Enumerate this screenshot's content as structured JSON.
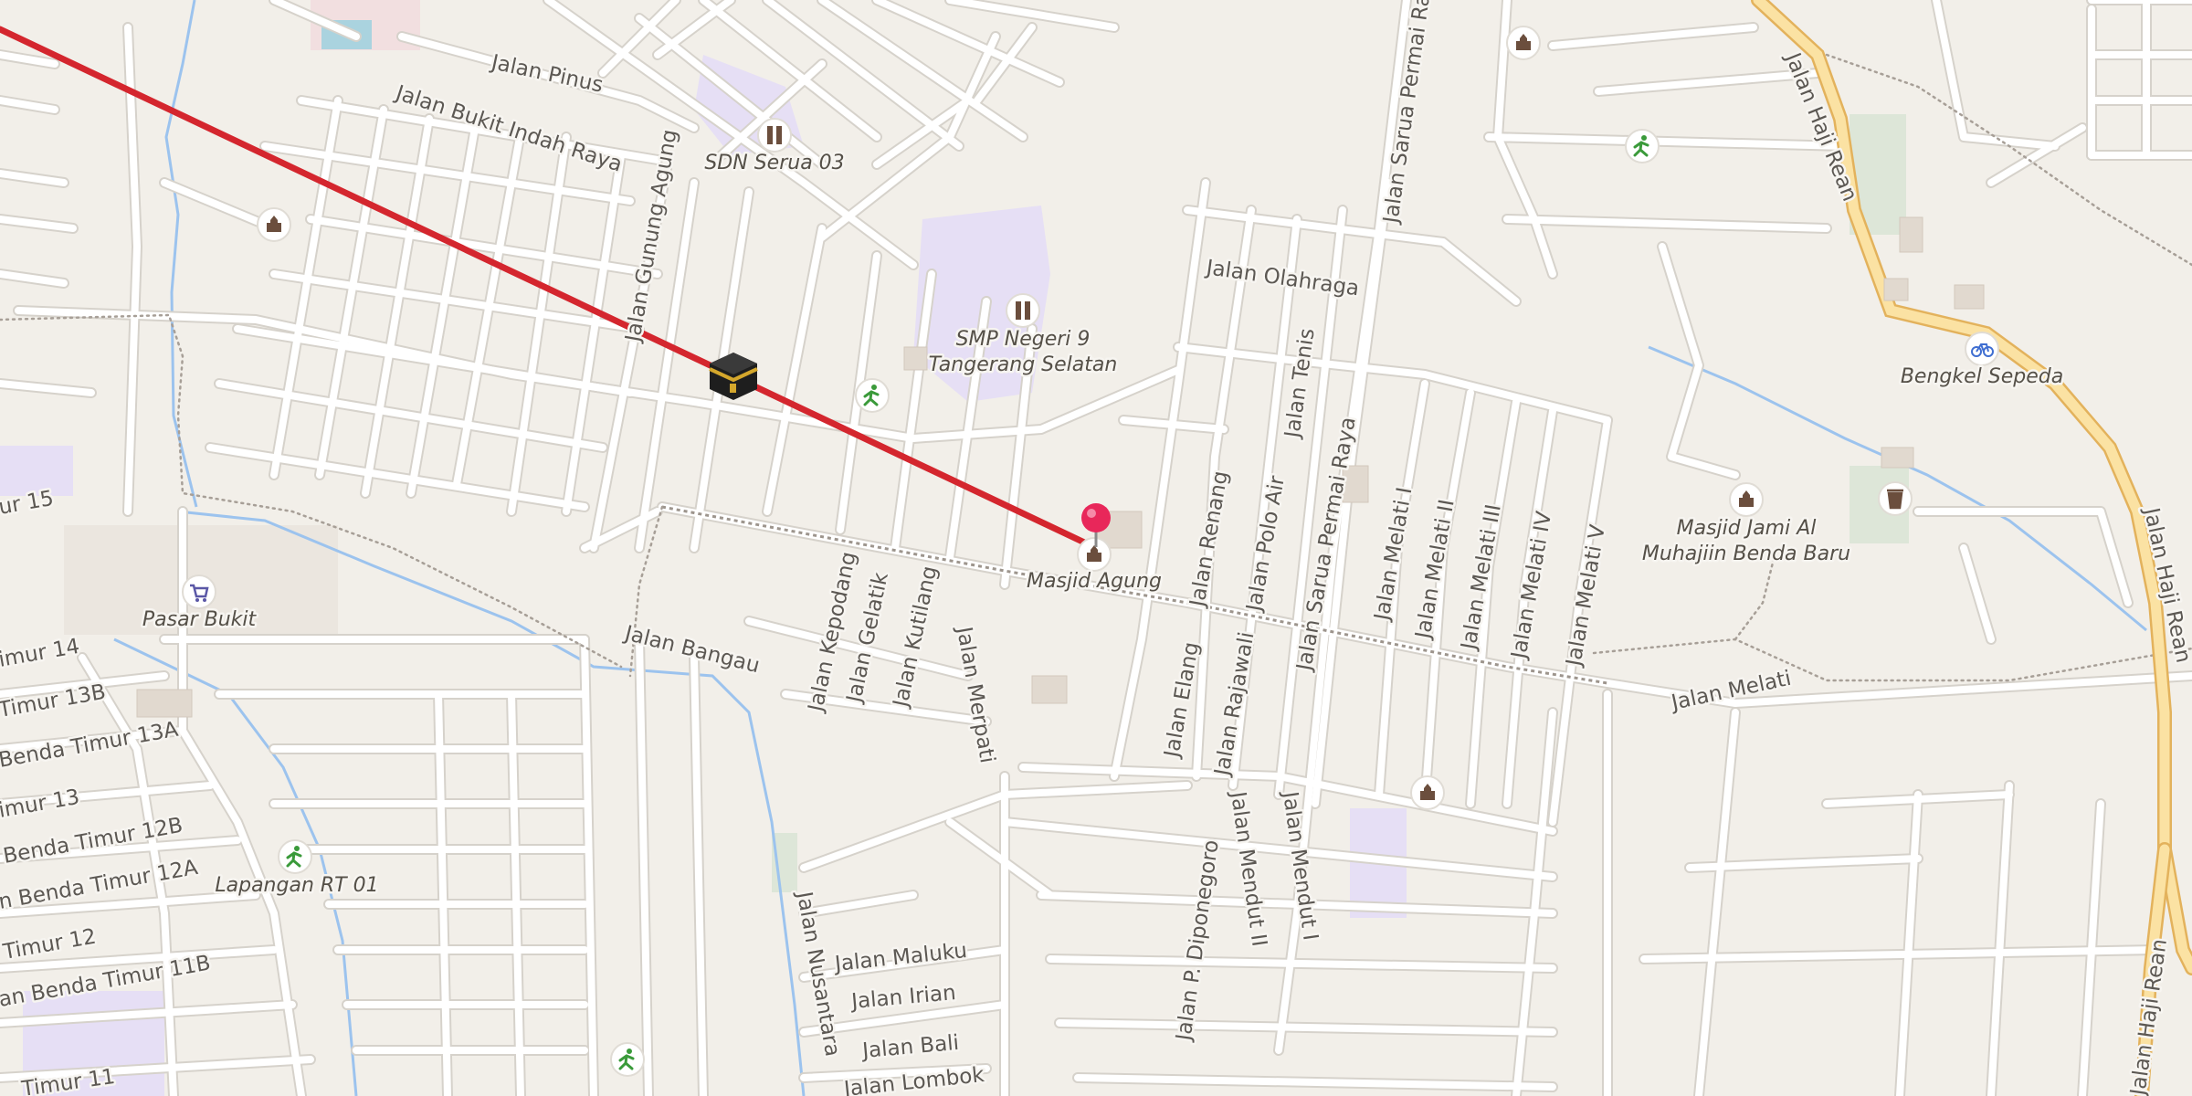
{
  "map": {
    "colors": {
      "background": "#f2efe9",
      "road": "#ffffff",
      "road_casing": "#d6d2cb",
      "major_road": "#fbe2a3",
      "major_road_casing": "#e3b25c",
      "route_line": "#d4262e",
      "pin": "#e8275a",
      "river": "#9cc3ee",
      "school_area": "#e6dff5",
      "park_area": "#dde6d8"
    },
    "streets": [
      "Jalan Pinus",
      "Jalan Bukit Indah Raya",
      "Jalan Gunung Agung",
      "Jalan Olahraga",
      "Jalan Sarua Permai Raya",
      "Jalan Sarua Permai Raya",
      "Jalan Tenis",
      "Jalan Polo Air",
      "Jalan Renang",
      "Jalan Rajawali",
      "Jalan Elang",
      "Jalan Melati I",
      "Jalan Melati II",
      "Jalan Melati III",
      "Jalan Melati IV",
      "Jalan Melati V",
      "Jalan Melati",
      "Jalan Haji Rean",
      "Jalan Haji Rean",
      "Jalan Haji Rean",
      "Jalan Bangau",
      "Jalan Kepodang",
      "Jalan Gelatik",
      "Jalan Kutilang",
      "Jalan Merpati",
      "Jalan P. Diponegoro",
      "Jalan Mendut II",
      "Jalan Mendut I",
      "Jalan Nusantara",
      "Jalan Maluku",
      "Jalan Irian",
      "Jalan Bali",
      "Jalan Lombok",
      "ur 15",
      "imur 14",
      "Timur 13B",
      "Benda Timur 13A",
      "imur 13",
      "Benda Timur 12B",
      "n Benda Timur 12A",
      "Timur 12",
      "an Benda Timur 11B",
      "Timur 11"
    ],
    "pois": [
      {
        "name": "SDN Serua 03",
        "icon": "school-icon"
      },
      {
        "name": "SMP Negeri 9",
        "name2": "Tangerang Selatan",
        "icon": "school-icon"
      },
      {
        "name": "Masjid Agung",
        "icon": "mosque-icon"
      },
      {
        "name": "Pasar Bukit",
        "icon": "shopping-cart-icon"
      },
      {
        "name": "Lapangan RT 01",
        "icon": "sports-field-icon"
      },
      {
        "name": "Bengkel Sepeda",
        "icon": "bicycle-icon"
      },
      {
        "name": "Masjid Jami Al",
        "name2": "Muhajiin Benda Baru",
        "icon": "mosque-icon"
      }
    ],
    "markers": {
      "qibla": "kaaba-icon",
      "destination": "location-pin-icon"
    },
    "route": "Qibla direction line"
  }
}
